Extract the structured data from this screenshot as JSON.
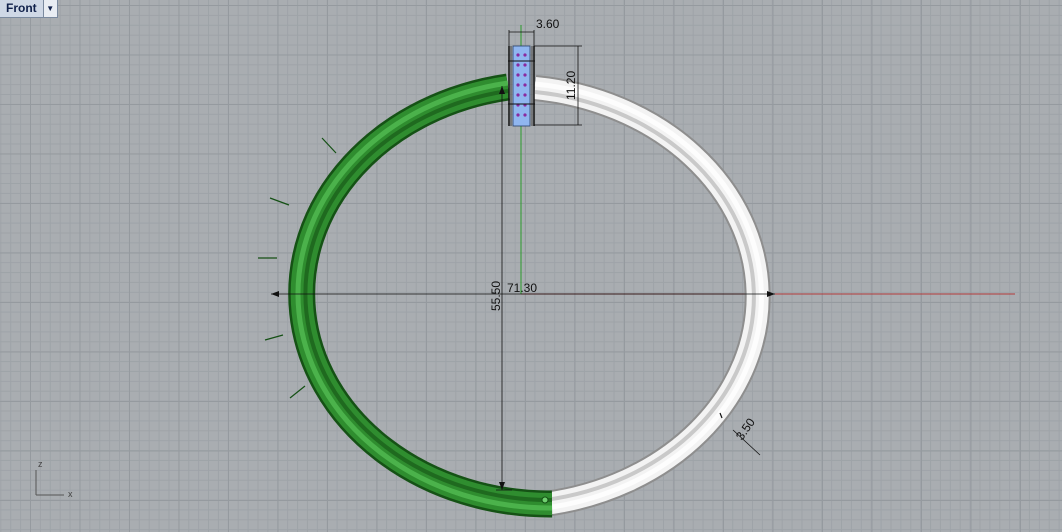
{
  "viewport": {
    "name": "Front",
    "menu_icon": "triangle-down-icon"
  },
  "dimensions": {
    "gap_width": "3.60",
    "clasp_height": "11.20",
    "outer_width": "71.30",
    "inner_height": "55.50",
    "wire_thickness": "3.50"
  },
  "axis_widget": {
    "z": "z",
    "x": "x"
  },
  "colors": {
    "viewport_bg": "#a9adb1",
    "green_half": "#2e8a2e",
    "white_half": "#e6e6e6",
    "clasp_fill": "#8fb5ef",
    "x_axis": "#b23b3b",
    "y_axis": "#2a9a2a"
  }
}
